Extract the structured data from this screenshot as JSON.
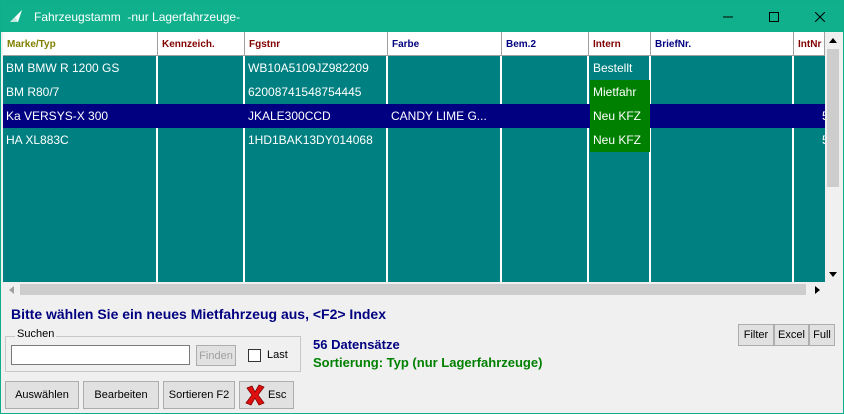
{
  "window": {
    "title": "Fahrzeugstamm  -nur Lagerfahrzeuge-",
    "colors": {
      "titlebar": "#10b08c",
      "grid_bg": "#008080",
      "selected": "#000080",
      "intern_green": "#008000"
    }
  },
  "grid": {
    "columns": [
      {
        "label": "Marke/Typ",
        "color": "#808000"
      },
      {
        "label": "Kennzeich.",
        "color": "#800000"
      },
      {
        "label": "Fgstnr",
        "color": "#800000"
      },
      {
        "label": "Farbe",
        "color": "#000080"
      },
      {
        "label": "Bem.2",
        "color": "#000080"
      },
      {
        "label": "Intern",
        "color": "#800000"
      },
      {
        "label": "BriefNr.",
        "color": "#000080"
      },
      {
        "label": "IntNr",
        "color": "#800000"
      }
    ],
    "rows": [
      {
        "marke": "BM BMW R 1200 GS",
        "kennz": "",
        "fgstnr": "WB10A5109JZ982209",
        "farbe": "",
        "bem2": "",
        "intern": "Bestellt",
        "intern_green": false,
        "brief": "",
        "intnr": ""
      },
      {
        "marke": "BM R80/7",
        "kennz": "",
        "fgstnr": "62008741548754445",
        "farbe": "",
        "bem2": "",
        "intern": "Mietfahr",
        "intern_green": true,
        "brief": "",
        "intnr": ""
      },
      {
        "marke": "Ka VERSYS-X 300",
        "kennz": "",
        "fgstnr": "JKALE300CCD",
        "farbe": "CANDY LIME G...",
        "bem2": "",
        "intern": "Neu KFZ",
        "intern_green": true,
        "brief": "",
        "intnr": "5"
      },
      {
        "marke": "HA XL883C",
        "kennz": "",
        "fgstnr": "1HD1BAK13DY014068",
        "farbe": "",
        "bem2": "",
        "intern": "Neu KFZ",
        "intern_green": true,
        "brief": "",
        "intnr": "5"
      }
    ],
    "selected_row": 2
  },
  "prompt": "Bitte wählen Sie ein neues Mietfahrzeug aus, <F2> Index",
  "search": {
    "legend": "Suchen",
    "value": "",
    "find_label": "Finden",
    "last_label": "Last",
    "last_checked": false
  },
  "status": {
    "records": "56 Datensätze",
    "sorting": "Sortierung: Typ (nur Lagerfahrzeuge)"
  },
  "toolbar": {
    "filter_label": "Filter",
    "excel_label": "Excel",
    "full_label": "Full"
  },
  "actions": {
    "select_label": "Auswählen",
    "edit_label": "Bearbeiten",
    "sort_label": "Sortieren F2",
    "esc_label": "Esc"
  }
}
